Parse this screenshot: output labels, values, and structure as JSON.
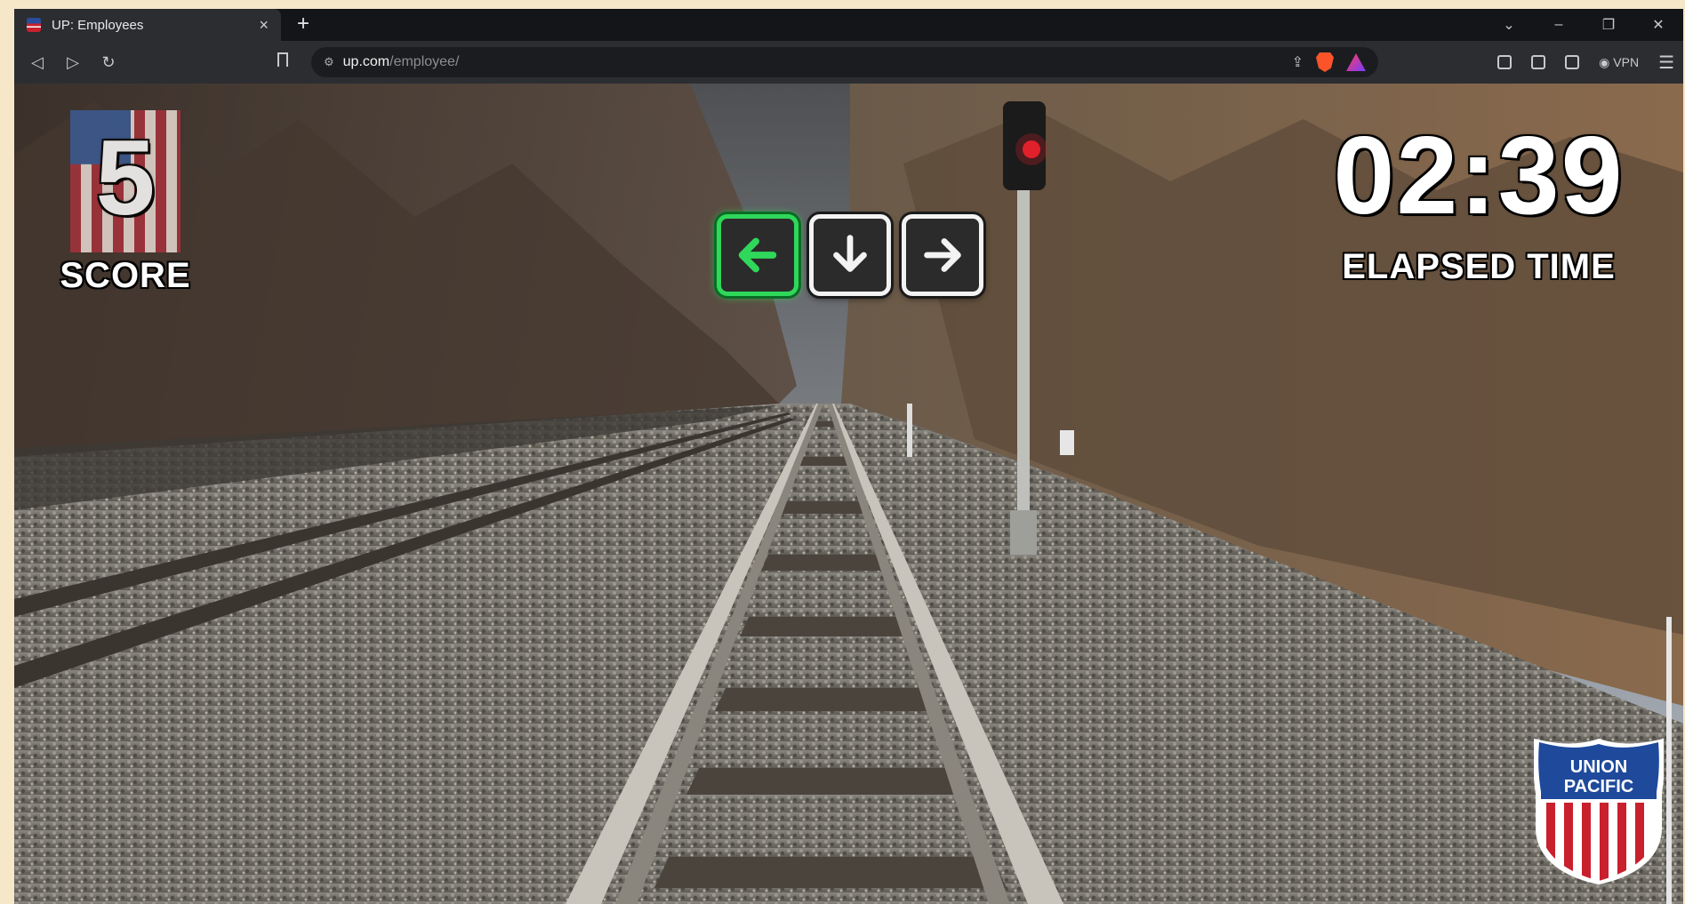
{
  "browser": {
    "tab_title": "UP: Employees",
    "tab_close": "×",
    "new_tab": "+",
    "window_controls": [
      "⌄",
      "–",
      "❐",
      "✕"
    ],
    "nav": {
      "back": "◁",
      "forward": "▷",
      "reload": "↻"
    },
    "url_host": "up.com",
    "url_path": "/employee/",
    "vpn_label": "VPN"
  },
  "game": {
    "score_value": "5",
    "score_label": "SCORE",
    "elapsed_value": "02:39",
    "elapsed_label": "ELAPSED TIME",
    "arrow_keys": [
      {
        "direction": "left",
        "active": true
      },
      {
        "direction": "down",
        "active": false
      },
      {
        "direction": "right",
        "active": false
      }
    ],
    "logo": {
      "line1": "UNION",
      "line2": "PACIFIC"
    },
    "colors": {
      "active_key": "#2fd85a",
      "signal_light": "#e0202a",
      "logo_blue": "#1f4a9c",
      "logo_red": "#c9202d"
    }
  }
}
